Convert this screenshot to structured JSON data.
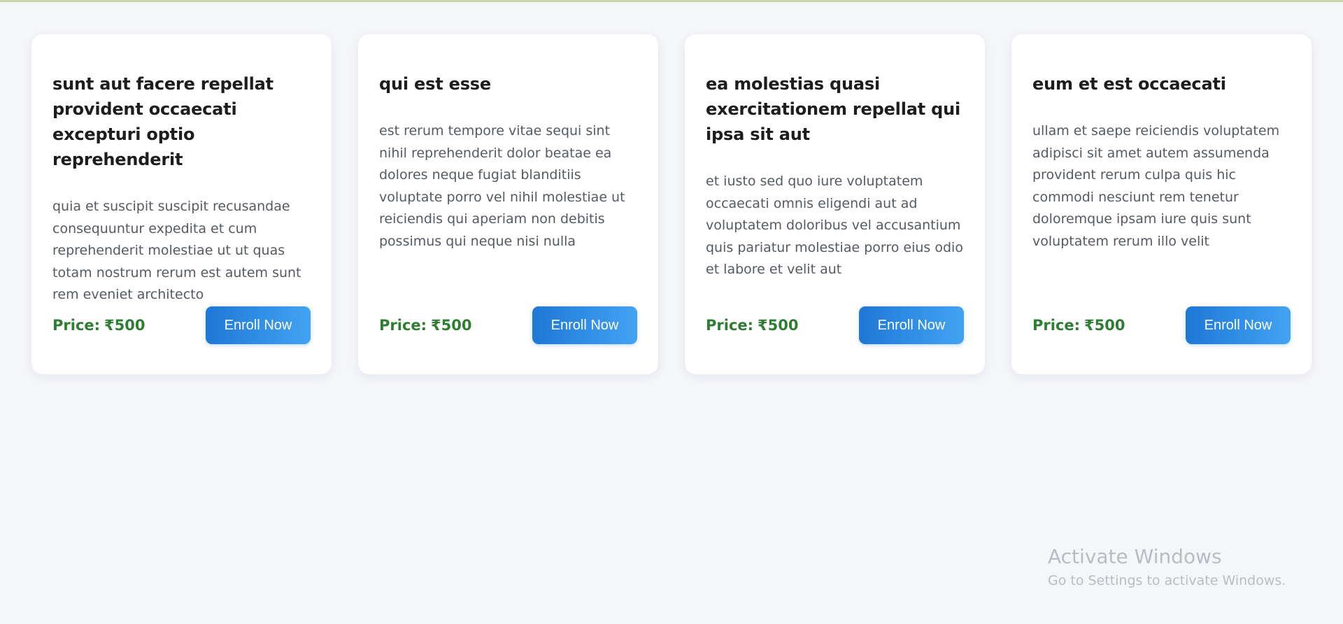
{
  "theme": {
    "page_bg": "#f5f6fa",
    "card_bg": "#ffffff",
    "price_color": "#2e7d32",
    "button_gradient": [
      "#1e78d6",
      "#43a3f2"
    ],
    "watermark_color": "#b9bcc2"
  },
  "cards": [
    {
      "title": "sunt aut facere repellat provident occaecati excepturi optio reprehenderit",
      "body": "quia et suscipit suscipit recusandae consequuntur expedita et cum reprehenderit molestiae ut ut quas totam nostrum rerum est autem sunt rem eveniet architecto",
      "price_label": "Price:",
      "price_value": "₹500",
      "button_label": "Enroll Now"
    },
    {
      "title": "qui est esse",
      "body": "est rerum tempore vitae sequi sint nihil reprehenderit dolor beatae ea dolores neque fugiat blanditiis voluptate porro vel nihil molestiae ut reiciendis qui aperiam non debitis possimus qui neque nisi nulla",
      "price_label": "Price:",
      "price_value": "₹500",
      "button_label": "Enroll Now"
    },
    {
      "title": "ea molestias quasi exercitationem repellat qui ipsa sit aut",
      "body": "et iusto sed quo iure voluptatem occaecati omnis eligendi aut ad voluptatem doloribus vel accusantium quis pariatur molestiae porro eius odio et labore et velit aut",
      "price_label": "Price:",
      "price_value": "₹500",
      "button_label": "Enroll Now"
    },
    {
      "title": "eum et est occaecati",
      "body": "ullam et saepe reiciendis voluptatem adipisci sit amet autem assumenda provident rerum culpa quis hic commodi nesciunt rem tenetur doloremque ipsam iure quis sunt voluptatem rerum illo velit",
      "price_label": "Price:",
      "price_value": "₹500",
      "button_label": "Enroll Now"
    }
  ],
  "watermark": {
    "title": "Activate Windows",
    "subtitle": "Go to Settings to activate Windows."
  }
}
